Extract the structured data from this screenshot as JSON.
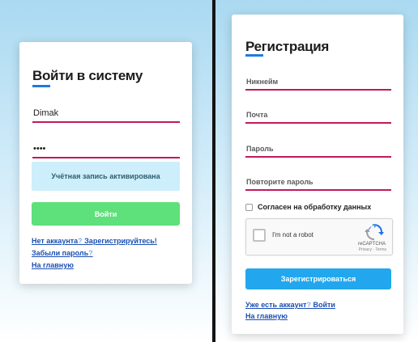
{
  "login": {
    "title": "Войти в систему",
    "username_value": "Dimak",
    "password_value": "••••",
    "status_message": "Учётная запись активирована",
    "submit_label": "Войти",
    "links": {
      "no_account_prefix": "Нет аккаунта",
      "no_account_q": "?",
      "register_text": " Зарегистрируйтесь!",
      "forgot_text": "Забыли пароль",
      "forgot_q": "?",
      "home_text": "На главную"
    },
    "colors": {
      "accent": "#1f7ae0",
      "field_underline": "#c2185b",
      "button": "#5ee07a",
      "status_bg": "#cdeefb"
    }
  },
  "register": {
    "title": "Регистрация",
    "nickname_placeholder": "Никнейм",
    "email_placeholder": "Почта",
    "password_placeholder": "Пароль",
    "repeat_password_placeholder": "Повторите пароль",
    "consent_label": "Согласен на обработку данных",
    "captcha": {
      "label": "I'm not a robot",
      "brand": "reCAPTCHA",
      "terms": "Privacy - Terms"
    },
    "submit_label": "Зарегистрироваться",
    "links": {
      "have_account_prefix": "Уже есть аккаунт",
      "have_account_q": "?",
      "login_text": " Войти",
      "home_text": "На главную"
    },
    "colors": {
      "button": "#22a7ee"
    }
  }
}
